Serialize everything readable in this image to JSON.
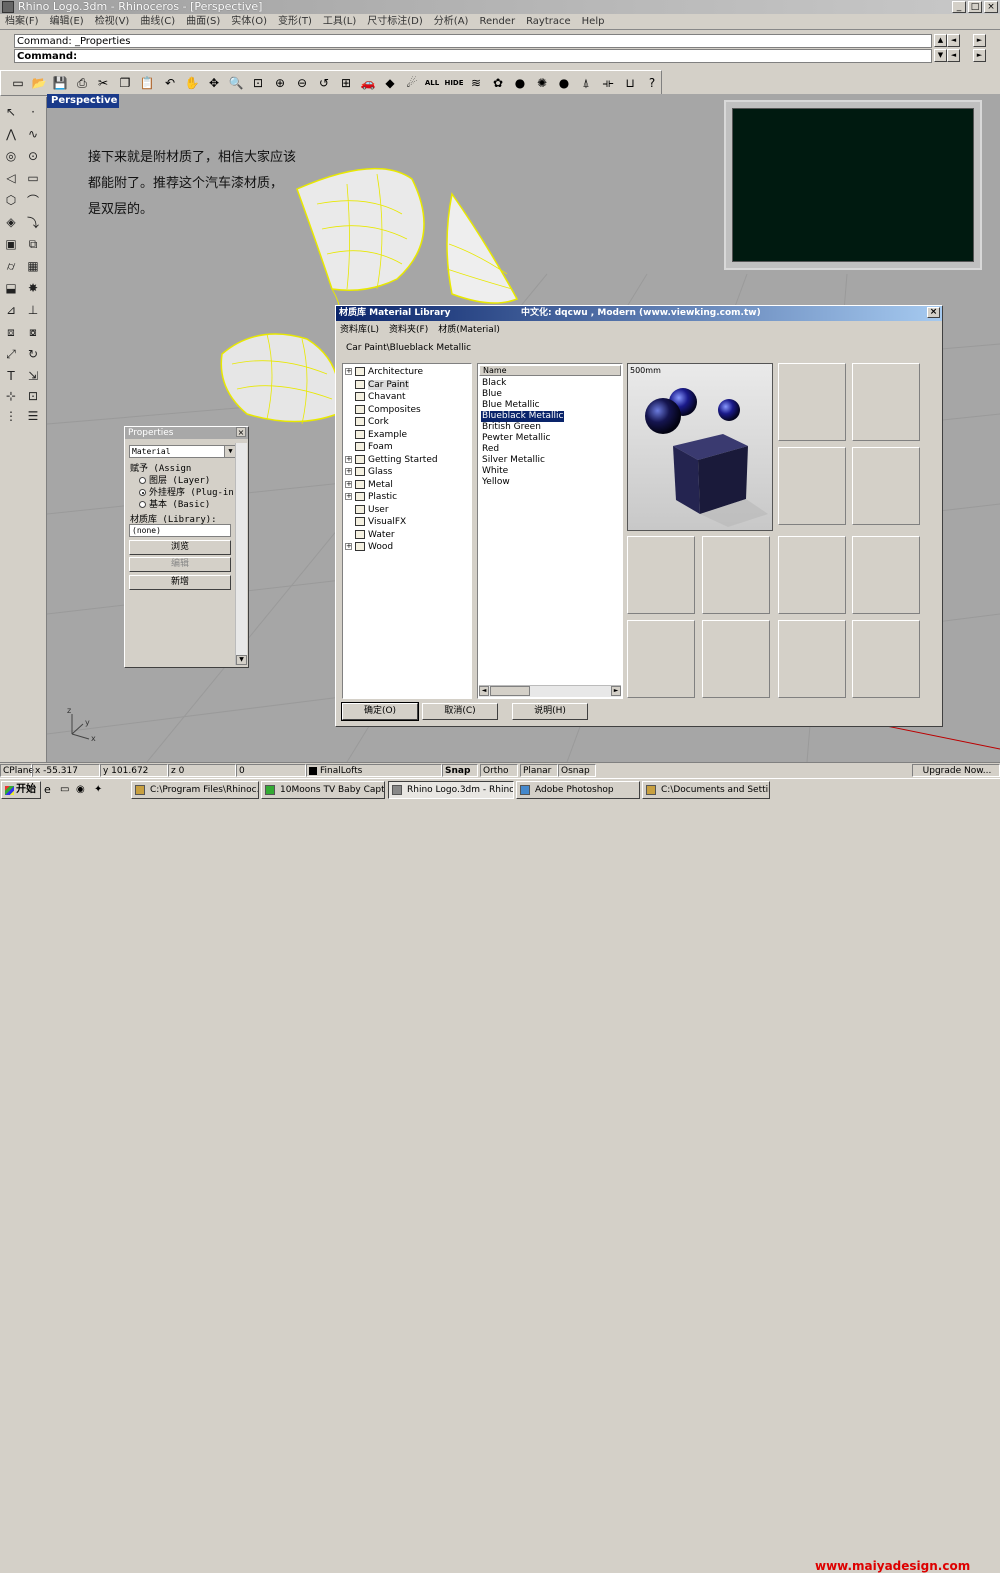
{
  "window": {
    "title": "Rhino Logo.3dm - Rhinoceros - [Perspective]"
  },
  "menu": [
    "档案(F)",
    "编辑(E)",
    "检视(V)",
    "曲线(C)",
    "曲面(S)",
    "实体(O)",
    "变形(T)",
    "工具(L)",
    "尺寸标注(D)",
    "分析(A)",
    "Render",
    "Raytrace",
    "Help"
  ],
  "command": {
    "history": "Command: _Properties",
    "prompt": "Command:"
  },
  "toolbar": {
    "all_label": "ALL",
    "hide_label": "HIDE"
  },
  "viewport": {
    "name": "Perspective",
    "note_lines": [
      "接下来就是附材质了，相信大家应该",
      "都能附了。推荐这个汽车漆材质，",
      "是双层的。"
    ],
    "axis_x": "x",
    "axis_y": "y",
    "axis_z": "z"
  },
  "properties": {
    "title": "Properties",
    "type_select": "Material",
    "assign_label": "赋予 (Assign",
    "options": [
      "图层 (Layer)",
      "外挂程序 (Plug-in",
      "基本 (Basic)"
    ],
    "library_label": "材质库 (Library):",
    "library_value": "(none)",
    "browse_btn": "浏览",
    "edit_btn": "编辑",
    "new_btn": "新增"
  },
  "material_library": {
    "title": "材质库   Material Library",
    "credit": "中文化: dqcwu , Modern  (www.viewking.com.tw)",
    "menu": [
      "资料库(L)",
      "资料夹(F)",
      "材质(Material)"
    ],
    "path": "Car Paint\\Blueblack Metallic",
    "tree": [
      {
        "label": "Architecture",
        "exp": "+"
      },
      {
        "label": "Car Paint",
        "exp": "",
        "selected": true
      },
      {
        "label": "Chavant",
        "exp": ""
      },
      {
        "label": "Composites",
        "exp": ""
      },
      {
        "label": "Cork",
        "exp": ""
      },
      {
        "label": "Example",
        "exp": ""
      },
      {
        "label": "Foam",
        "exp": ""
      },
      {
        "label": "Getting Started",
        "exp": "+"
      },
      {
        "label": "Glass",
        "exp": "+"
      },
      {
        "label": "Metal",
        "exp": "+"
      },
      {
        "label": "Plastic",
        "exp": "+"
      },
      {
        "label": "User",
        "exp": ""
      },
      {
        "label": "VisualFX",
        "exp": ""
      },
      {
        "label": "Water",
        "exp": ""
      },
      {
        "label": "Wood",
        "exp": "+"
      }
    ],
    "list_header": "Name",
    "list": [
      "Black",
      "Blue",
      "Blue Metallic",
      "Blueblack Metallic",
      "British Green",
      "Pewter Metallic",
      "Red",
      "Silver Metallic",
      "White",
      "Yellow"
    ],
    "selected_item": "Blueblack Metallic",
    "preview_label": "500mm",
    "ok_btn": "确定(O)",
    "cancel_btn": "取消(C)",
    "help_btn": "说明(H)"
  },
  "status": {
    "cplane": "CPlane",
    "x": "x -55.317",
    "y": "y 101.672",
    "z": "z 0",
    "d": "0",
    "layer": "FinalLofts",
    "snap": "Snap",
    "ortho": "Ortho",
    "planar": "Planar",
    "osnap": "Osnap",
    "upgrade": "Upgrade Now..."
  },
  "taskbar": {
    "start": "开始",
    "tasks": [
      "C:\\Program Files\\Rhinoc...",
      "10Moons TV Baby Capture",
      "Rhino Logo.3dm - Rhinoc...",
      "Adobe Photoshop",
      "C:\\Documents and Settin..."
    ],
    "watermark": "www.maiyadesign.com"
  },
  "colors": {
    "selection": "#0a246a",
    "viewport_bg": "#a6a6a6",
    "wire": "#e8e800",
    "title_active": "#0a246a"
  }
}
